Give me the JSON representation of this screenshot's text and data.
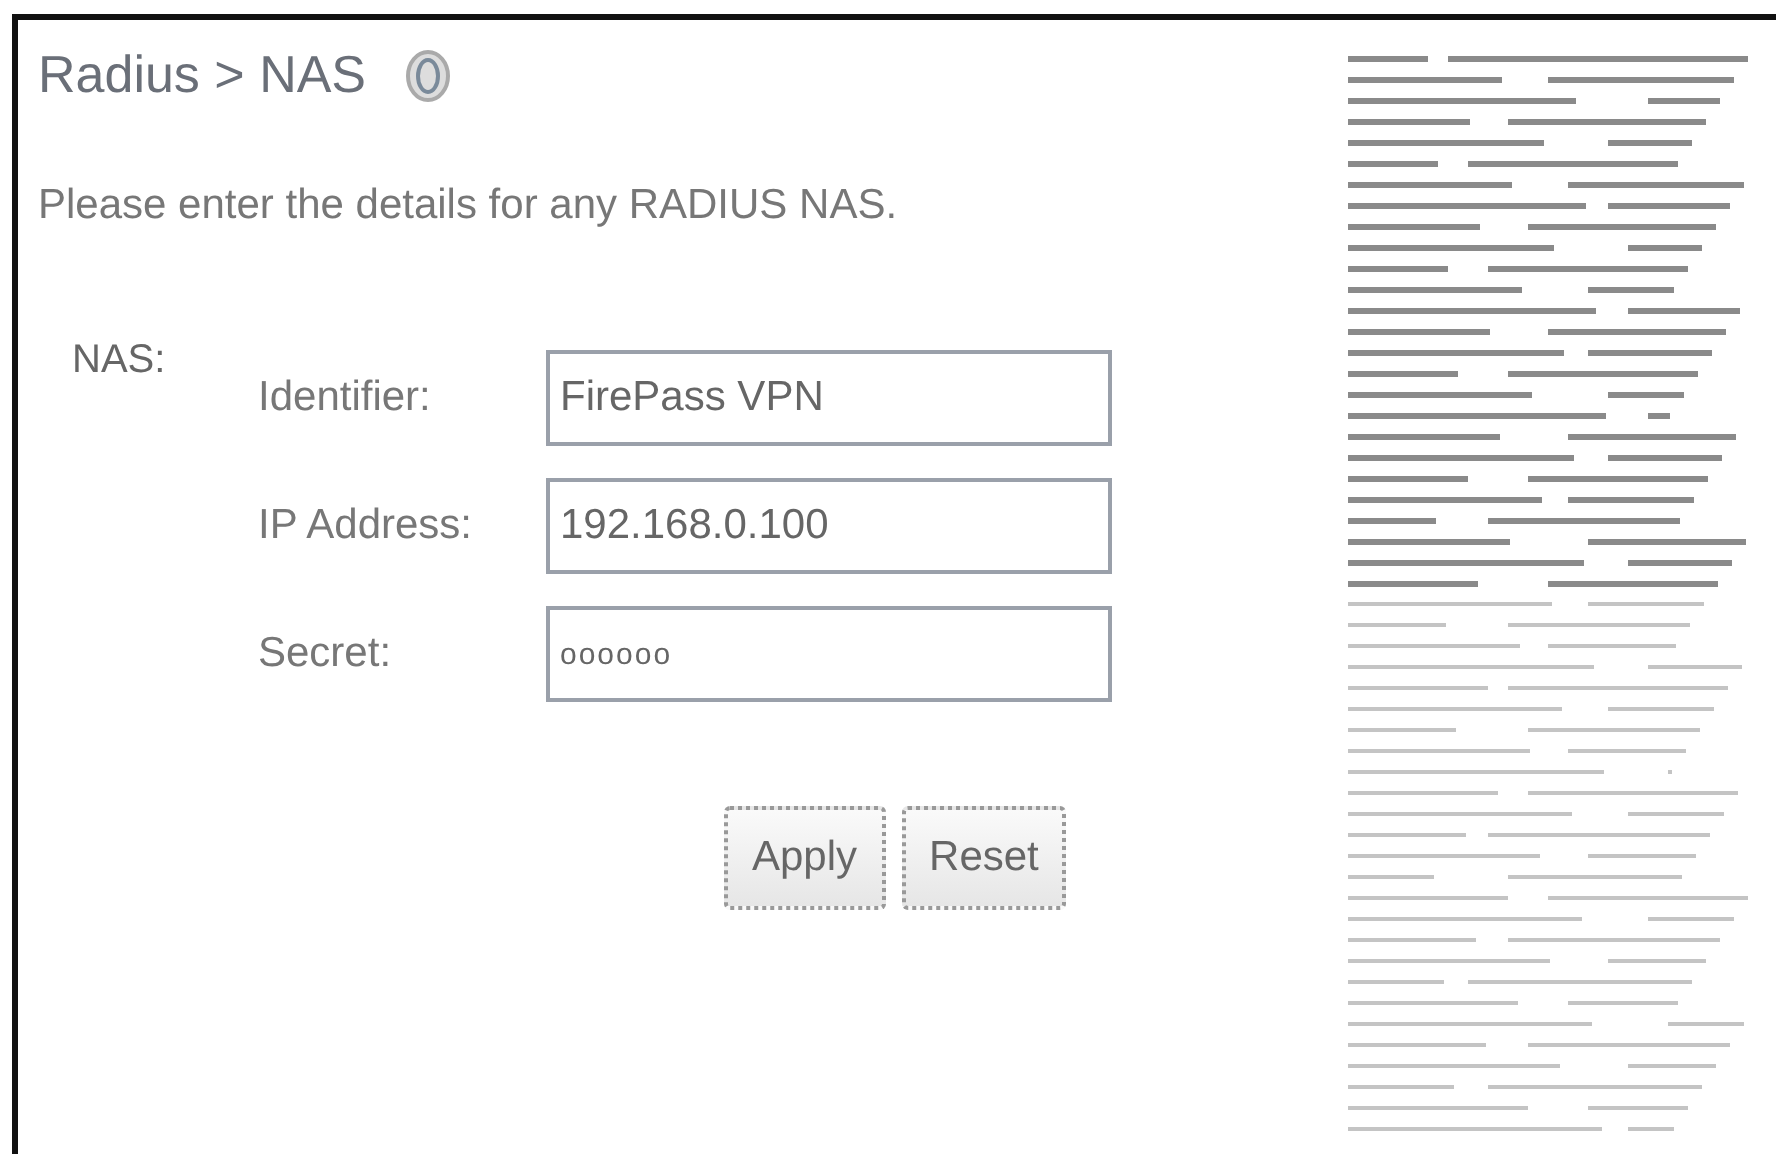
{
  "page": {
    "breadcrumb": "Radius > NAS",
    "instructions": "Please enter the details for any RADIUS NAS."
  },
  "nas": {
    "label": "NAS:",
    "fields": [
      {
        "label": "Identifier:",
        "value": "FirePass VPN",
        "kind": "text"
      },
      {
        "label": "IP Address:",
        "value": "192.168.0.100",
        "kind": "text"
      },
      {
        "label": "Secret:",
        "value": "oooooo",
        "kind": "secret"
      }
    ]
  },
  "buttons": [
    "Apply",
    "Reset"
  ]
}
